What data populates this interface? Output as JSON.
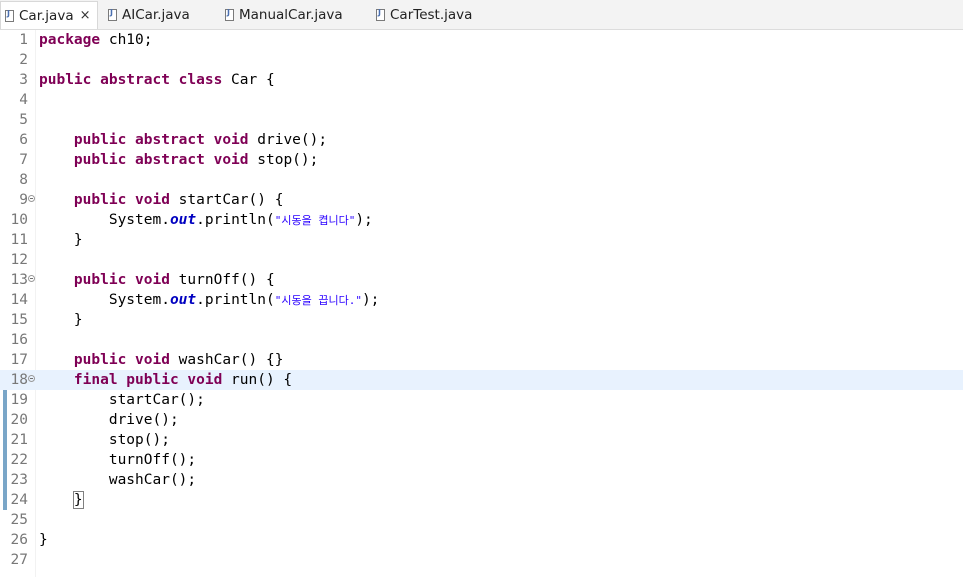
{
  "tabs": [
    {
      "label": "Car.java",
      "close": "×"
    },
    {
      "label": "AICar.java"
    },
    {
      "label": "ManualCar.java"
    },
    {
      "label": "CarTest.java"
    }
  ],
  "editor": {
    "current_line": 18,
    "lines": [
      {
        "n": "1",
        "kw1": "package",
        "rest": " ch10;"
      },
      {
        "n": "2"
      },
      {
        "n": "3",
        "kw1": "public abstract class",
        "rest": " Car {"
      },
      {
        "n": "4"
      },
      {
        "n": "5"
      },
      {
        "n": "6",
        "indent": "    ",
        "kw1": "public abstract void",
        "rest": " drive();"
      },
      {
        "n": "7",
        "indent": "    ",
        "kw1": "public abstract void",
        "rest": " stop();"
      },
      {
        "n": "8"
      },
      {
        "n": "9",
        "indent": "    ",
        "kw1": "public void",
        "rest": " startCar() {"
      },
      {
        "n": "10",
        "indent": "        ",
        "pre": "System.",
        "field": "out",
        "mid": ".println(",
        "str": "\"시동을 켭니다\"",
        "post": ");"
      },
      {
        "n": "11",
        "indent": "    ",
        "rest": "}"
      },
      {
        "n": "12"
      },
      {
        "n": "13",
        "indent": "    ",
        "kw1": "public void",
        "rest": " turnOff() {"
      },
      {
        "n": "14",
        "indent": "        ",
        "pre": "System.",
        "field": "out",
        "mid": ".println(",
        "str": "\"시동을 끕니다.\"",
        "post": ");"
      },
      {
        "n": "15",
        "indent": "    ",
        "rest": "}"
      },
      {
        "n": "16"
      },
      {
        "n": "17",
        "indent": "    ",
        "kw1": "public void",
        "rest": " washCar() {}"
      },
      {
        "n": "18",
        "indent": "    ",
        "kw1": "final public void",
        "rest": " run() {"
      },
      {
        "n": "19",
        "indent": "        ",
        "rest": "startCar();"
      },
      {
        "n": "20",
        "indent": "        ",
        "rest": "drive();"
      },
      {
        "n": "21",
        "indent": "        ",
        "rest": "stop();"
      },
      {
        "n": "22",
        "indent": "        ",
        "rest": "turnOff();"
      },
      {
        "n": "23",
        "indent": "        ",
        "rest": "washCar();"
      },
      {
        "n": "24",
        "indent": "    ",
        "bracket": "}"
      },
      {
        "n": "25"
      },
      {
        "n": "26",
        "rest": "}"
      },
      {
        "n": "27"
      }
    ]
  }
}
